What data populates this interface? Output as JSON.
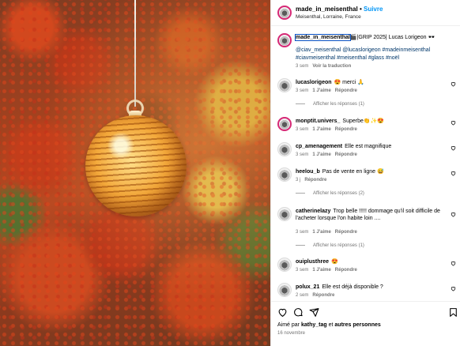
{
  "post_header": {
    "username": "made_in_meisenthal",
    "separator": "•",
    "follow_label": "Suivre",
    "location": "Meisenthal, Lorraine, France"
  },
  "caption": {
    "username": "made_in_meisenthal",
    "text": "🎬|GRIP 2025| Lucas Lorigeon 🕶️",
    "hashtags": "@ciav_meisenthal @lucaslorigeon #madeinmeisenthal #ciavmeisenthal #meisenthal #glass #noël",
    "time": "3 sem",
    "translate_label": "Voir la traduction"
  },
  "comments": [
    {
      "username": "lucaslorigeon",
      "text": "😍 merci 🙏",
      "time": "3 sem",
      "likes": "1 J'aime",
      "reply": "Répondre",
      "replies_label": "Afficher les réponses (1)"
    },
    {
      "username": "monptit.univers_",
      "text": "Superbe👏✨😍",
      "time": "3 sem",
      "likes": "1 J'aime",
      "reply": "Répondre",
      "replies_label": ""
    },
    {
      "username": "cp_amenagement",
      "text": "Elle est magnifique",
      "time": "3 sem",
      "likes": "1 J'aime",
      "reply": "Répondre",
      "replies_label": ""
    },
    {
      "username": "heelou_b",
      "text": "Pas de vente en ligne 😅",
      "time": "3 j",
      "likes": "",
      "reply": "Répondre",
      "replies_label": "Afficher les réponses (2)"
    },
    {
      "username": "catherinelazy",
      "text": "Trop belle !!!!! dommage qu'il soit difficile de l'acheter lorsque l'on habite loin ....",
      "time": "3 sem",
      "likes": "1 J'aime",
      "reply": "Répondre",
      "replies_label": "Afficher les réponses (1)"
    },
    {
      "username": "ouiplusthree",
      "text": "😍",
      "time": "3 sem",
      "likes": "1 J'aime",
      "reply": "Répondre",
      "replies_label": ""
    },
    {
      "username": "polux_21",
      "text": "Elle est déjà disponible ?",
      "time": "2 sem",
      "likes": "",
      "reply": "Répondre",
      "replies_label": ""
    }
  ],
  "footer": {
    "liked_prefix": "Aimé par",
    "liked_user": "kathy_tag",
    "liked_connector": "et",
    "liked_others": "autres personnes",
    "date": "16 novembre"
  },
  "icons": {
    "like": "heart-icon",
    "comment": "comment-icon",
    "share": "share-icon",
    "save": "bookmark-icon"
  },
  "colors": {
    "accent": "#0095f6",
    "hashtag": "#00376b",
    "muted": "#737373"
  }
}
